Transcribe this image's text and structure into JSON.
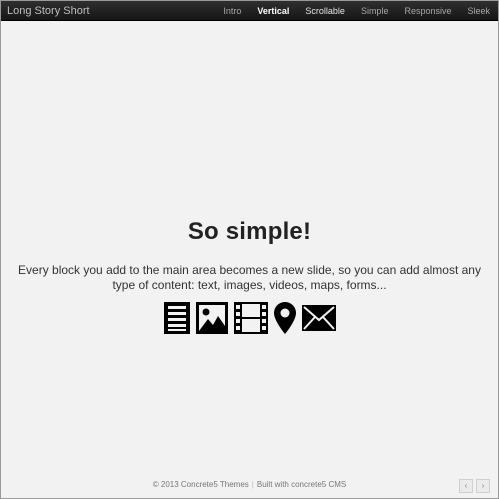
{
  "header": {
    "brand": "Long Story Short",
    "nav": [
      {
        "label": "Intro",
        "state": "normal"
      },
      {
        "label": "Vertical",
        "state": "active"
      },
      {
        "label": "Scrollable",
        "state": "light"
      },
      {
        "label": "Simple",
        "state": "normal"
      },
      {
        "label": "Responsive",
        "state": "normal"
      },
      {
        "label": "Sleek",
        "state": "normal"
      }
    ]
  },
  "slide": {
    "title": "So simple!",
    "description": "Every block you add to the main area becomes a new slide, so you can add almost any type of content: text, images, videos, maps, forms...",
    "icons": [
      "text-document-icon",
      "image-icon",
      "film-video-icon",
      "map-pin-icon",
      "envelope-icon"
    ]
  },
  "footer": {
    "copyright": "© 2013 Concrete5 Themes",
    "separator": "|",
    "built_with": "Built with concrete5 CMS"
  },
  "pager": {
    "prev": "‹",
    "next": "›"
  },
  "colors": {
    "navbar": "#1f1f1f",
    "background": "#f2f2f2",
    "title": "#222222"
  }
}
